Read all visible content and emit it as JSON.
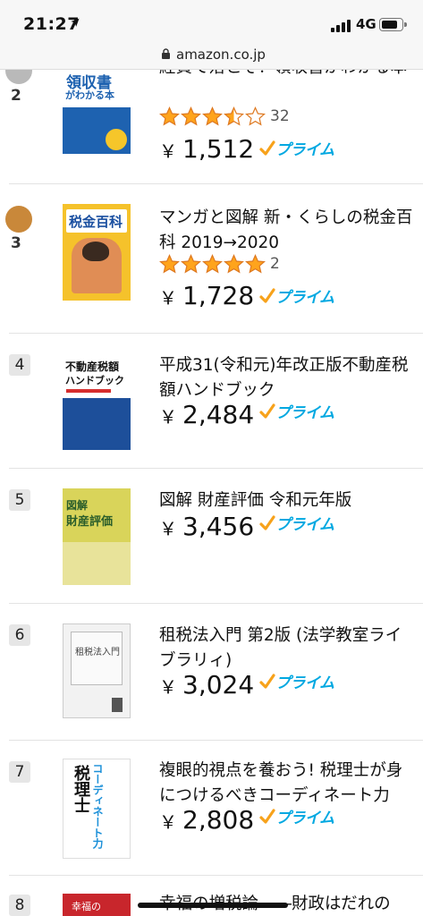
{
  "status_bar": {
    "time": "21:27",
    "location_arrow": "➤",
    "network": "4G",
    "icons": [
      "signal-icon",
      "battery-icon"
    ]
  },
  "browser": {
    "url": "amazon.co.jp",
    "lock_icon": "lock-icon"
  },
  "prime_label": "プライム",
  "currency": "￥",
  "items": [
    {
      "rank": "2",
      "title": "経費で落とそ！領収書がわかる本",
      "stars": 3.5,
      "reviews": "32",
      "price": "1,512",
      "prime": true,
      "cover_text": [
        "領収書",
        "がわかる本"
      ],
      "cover_color": "#1e62b0"
    },
    {
      "rank": "3",
      "title": "マンガと図解 新・くらしの税金百科 2019→2020",
      "stars": 5,
      "reviews": "2",
      "price": "1,728",
      "prime": true,
      "cover_text": [
        "税金百科"
      ],
      "cover_color": "#f5c22b"
    },
    {
      "rank": "4",
      "title": "平成31(令和元)年改正版不動産税額ハンドブック",
      "price": "2,484",
      "prime": true,
      "cover_text": [
        "不動産税額",
        "ハンドブック"
      ],
      "cover_color": "#1d4f9a"
    },
    {
      "rank": "5",
      "title": "図解 財産評価 令和元年版",
      "price": "3,456",
      "prime": true,
      "cover_text": [
        "図解",
        "財産評価"
      ],
      "cover_color": "#d9d45a"
    },
    {
      "rank": "6",
      "title": "租税法入門 第2版 (法学教室ライブラリィ)",
      "price": "3,024",
      "prime": true,
      "cover_text": [
        "租税法入門"
      ],
      "cover_color": "#f2f2f2"
    },
    {
      "rank": "7",
      "title": "複眼的視点を養おう! 税理士が身につけるべきコーディネート力",
      "price": "2,808",
      "prime": true,
      "cover_text": [
        "税理士",
        "コーディネート力"
      ],
      "cover_color": "#ffffff"
    },
    {
      "rank": "8",
      "title": "幸福の増税論――財政はだれの",
      "cover_text": [
        "幸福の"
      ],
      "cover_color": "#c8262c"
    }
  ]
}
